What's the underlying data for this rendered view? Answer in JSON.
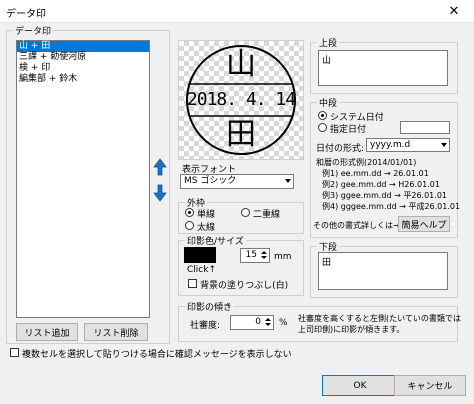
{
  "window": {
    "title": "データ印",
    "close_glyph": "✕"
  },
  "data_group": {
    "legend": "データ印",
    "items": [
      {
        "label": "山 + 田",
        "selected": true
      },
      {
        "label": "三課 + 勅使河原",
        "selected": false
      },
      {
        "label": "検 + 印",
        "selected": false
      },
      {
        "label": "編集部 + 鈴木",
        "selected": false
      }
    ],
    "add_button": "リスト追加",
    "delete_button": "リスト削除"
  },
  "stamp": {
    "top": "山",
    "middle": "2018. 4. 14",
    "bottom": "田",
    "color": "#000000"
  },
  "icons": {
    "up": "arrow-up-icon",
    "down": "arrow-down-icon",
    "accent": "#1a73c8"
  },
  "font": {
    "label": "表示フォント",
    "value": "MS ゴシック"
  },
  "frame": {
    "legend": "外枠",
    "options": [
      {
        "label": "単線",
        "checked": true
      },
      {
        "label": "二重線",
        "checked": false
      },
      {
        "label": "太線",
        "checked": false
      }
    ]
  },
  "size_color": {
    "legend": "印影色/サイズ",
    "click_hint": "Click↑",
    "size_value": "15",
    "size_unit": "mm",
    "fill_bg_label": "背景の塗りつぶし(白)"
  },
  "tilt": {
    "legend": "印影の傾き",
    "label": "社審度:",
    "value": "0",
    "unit": "%",
    "description_line1": "社審度を高くすると左側(たいていの書類では",
    "description_line2": "上司印側)に印影が傾きます。"
  },
  "upper": {
    "legend": "上段",
    "value": "山"
  },
  "middle": {
    "legend": "中段",
    "system_date_label": "システム日付",
    "specified_date_label": "指定日付",
    "date_format_label": "日付の形式:",
    "date_format_value": "yyyy.m.d",
    "examples_title": "和暦の形式例(2014/01/01)",
    "examples": [
      "例1) ee.mm.dd → 26.01.01",
      "例2) gee.mm.dd → H26.01.01",
      "例3) ggee.mm.dd → 平26.01.01",
      "例4) gggee.mm.dd → 平成26.01.01"
    ],
    "other_format_label": "その他の書式詳しくは→",
    "help_button": "簡易ヘルプ"
  },
  "lower": {
    "legend": "下段",
    "value": "田"
  },
  "bottom": {
    "multi_cell_label": "複数セルを選択して貼りつける場合に確認メッセージを表示しない",
    "ok_button": "OK",
    "cancel_button": "キャンセル"
  }
}
